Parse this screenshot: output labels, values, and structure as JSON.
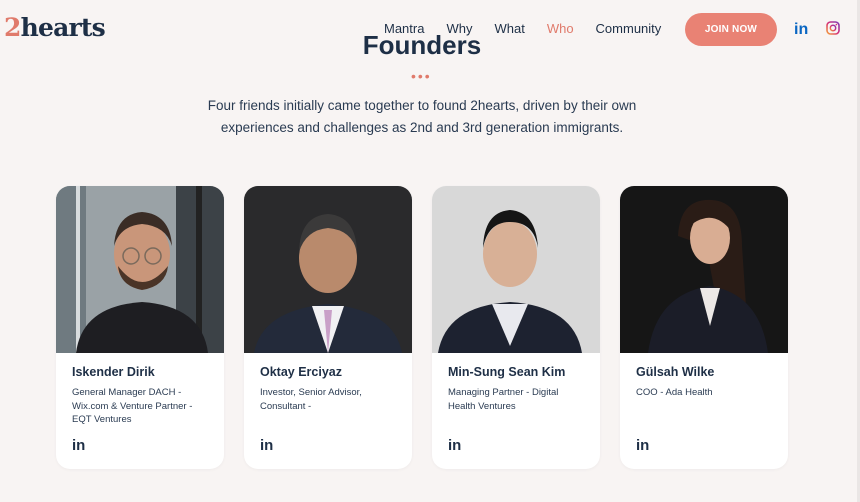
{
  "brand": {
    "logo_num": "2",
    "logo_text": "hearts"
  },
  "nav": [
    {
      "label": "Mantra",
      "active": false
    },
    {
      "label": "Why",
      "active": false
    },
    {
      "label": "What",
      "active": false
    },
    {
      "label": "Who",
      "active": true
    },
    {
      "label": "Community",
      "active": false
    }
  ],
  "header": {
    "join_label": "JOIN NOW",
    "linkedin_icon": "linkedin-icon",
    "instagram_icon": "instagram-icon"
  },
  "hero": {
    "title": "Founders",
    "dots": "•••",
    "intro": "Four friends initially came together to found 2hearts, driven by their own experiences and challenges as 2nd and 3rd generation immigrants."
  },
  "colors": {
    "accent": "#e98274",
    "navy": "#1e2f46",
    "background": "#f8f4f3"
  },
  "founders": [
    {
      "name": "Iskender Dirik",
      "role": "General Manager DACH - Wix.com & Venture Partner - EQT Ventures",
      "linkedin": "in"
    },
    {
      "name": "Oktay Erciyaz",
      "role": "Investor, Senior Advisor, Consultant  -",
      "linkedin": "in"
    },
    {
      "name": "Min-Sung Sean Kim",
      "role": "Managing Partner - Digital Health Ventures",
      "linkedin": "in"
    },
    {
      "name": "Gülsah Wilke",
      "role": "COO - Ada Health",
      "linkedin": "in"
    }
  ]
}
